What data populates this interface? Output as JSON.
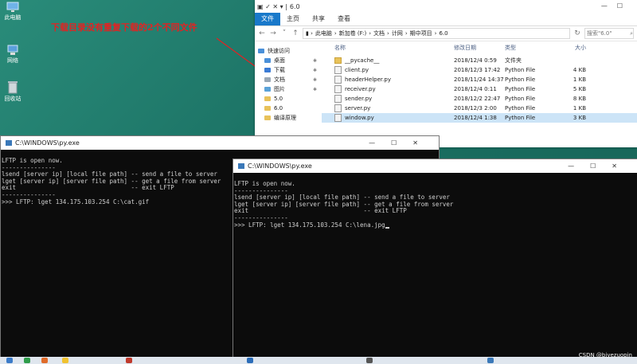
{
  "desktop": {
    "icons": [
      {
        "label": "此电脑",
        "icon": "computer-icon"
      },
      {
        "label": "网络",
        "icon": "network-icon"
      },
      {
        "label": "回收站",
        "icon": "recycle-bin-icon"
      }
    ],
    "annotation": "下载目录没有重复下载的2个不同文件",
    "accent": "#e32222"
  },
  "explorer": {
    "title": "6.0",
    "ribbon_tabs": [
      "文件",
      "主页",
      "共享",
      "查看"
    ],
    "breadcrumb": [
      "此电脑",
      "新加卷 (F:)",
      "文档",
      "计网",
      "期中项目",
      "6.0"
    ],
    "search_placeholder": "搜索\"6.0\"",
    "nav": [
      {
        "label": "快速访问",
        "pinned": false
      },
      {
        "label": "桌面",
        "pinned": true
      },
      {
        "label": "下载",
        "pinned": true
      },
      {
        "label": "文档",
        "pinned": true
      },
      {
        "label": "图片",
        "pinned": true
      },
      {
        "label": "5.0",
        "pinned": false
      },
      {
        "label": "6.0",
        "pinned": false
      },
      {
        "label": "编译原理",
        "pinned": false
      }
    ],
    "columns": [
      "名称",
      "修改日期",
      "类型",
      "大小"
    ],
    "files": [
      {
        "name": "__pycache__",
        "date": "2018/12/4 0:59",
        "type": "文件夹",
        "size": "",
        "kind": "folder"
      },
      {
        "name": "client.py",
        "date": "2018/12/3 17:42",
        "type": "Python File",
        "size": "4 KB",
        "kind": "py"
      },
      {
        "name": "headerHelper.py",
        "date": "2018/11/24 14:37",
        "type": "Python File",
        "size": "1 KB",
        "kind": "py"
      },
      {
        "name": "receiver.py",
        "date": "2018/12/4 0:11",
        "type": "Python File",
        "size": "5 KB",
        "kind": "py"
      },
      {
        "name": "sender.py",
        "date": "2018/12/2 22:47",
        "type": "Python File",
        "size": "8 KB",
        "kind": "py"
      },
      {
        "name": "server.py",
        "date": "2018/12/3 2:00",
        "type": "Python File",
        "size": "1 KB",
        "kind": "py"
      },
      {
        "name": "window.py",
        "date": "2018/12/4 1:38",
        "type": "Python File",
        "size": "3 KB",
        "kind": "py",
        "selected": true
      }
    ]
  },
  "console1": {
    "title": "C:\\WINDOWS\\py.exe",
    "lines": [
      "LFTP is open now.",
      "---------------",
      "lsend [server ip] [local file path] -- send a file to server",
      "lget [server ip] [server file path] -- get a file from server",
      "exit                                -- exit LFTP",
      "---------------",
      ">>> LFTP: lget 134.175.103.254 C:\\cat.gif"
    ]
  },
  "console2": {
    "title": "C:\\WINDOWS\\py.exe",
    "lines": [
      "LFTP is open now.",
      "---------------",
      "lsend [server ip] [local file path] -- send a file to server",
      "lget [server ip] [server file path] -- get a file from server",
      "exit                                -- exit LFTP",
      "---------------",
      ">>> LFTP: lget 134.175.103.254 C:\\lena.jpg"
    ]
  },
  "watermark": "CSDN @biyezuopin"
}
